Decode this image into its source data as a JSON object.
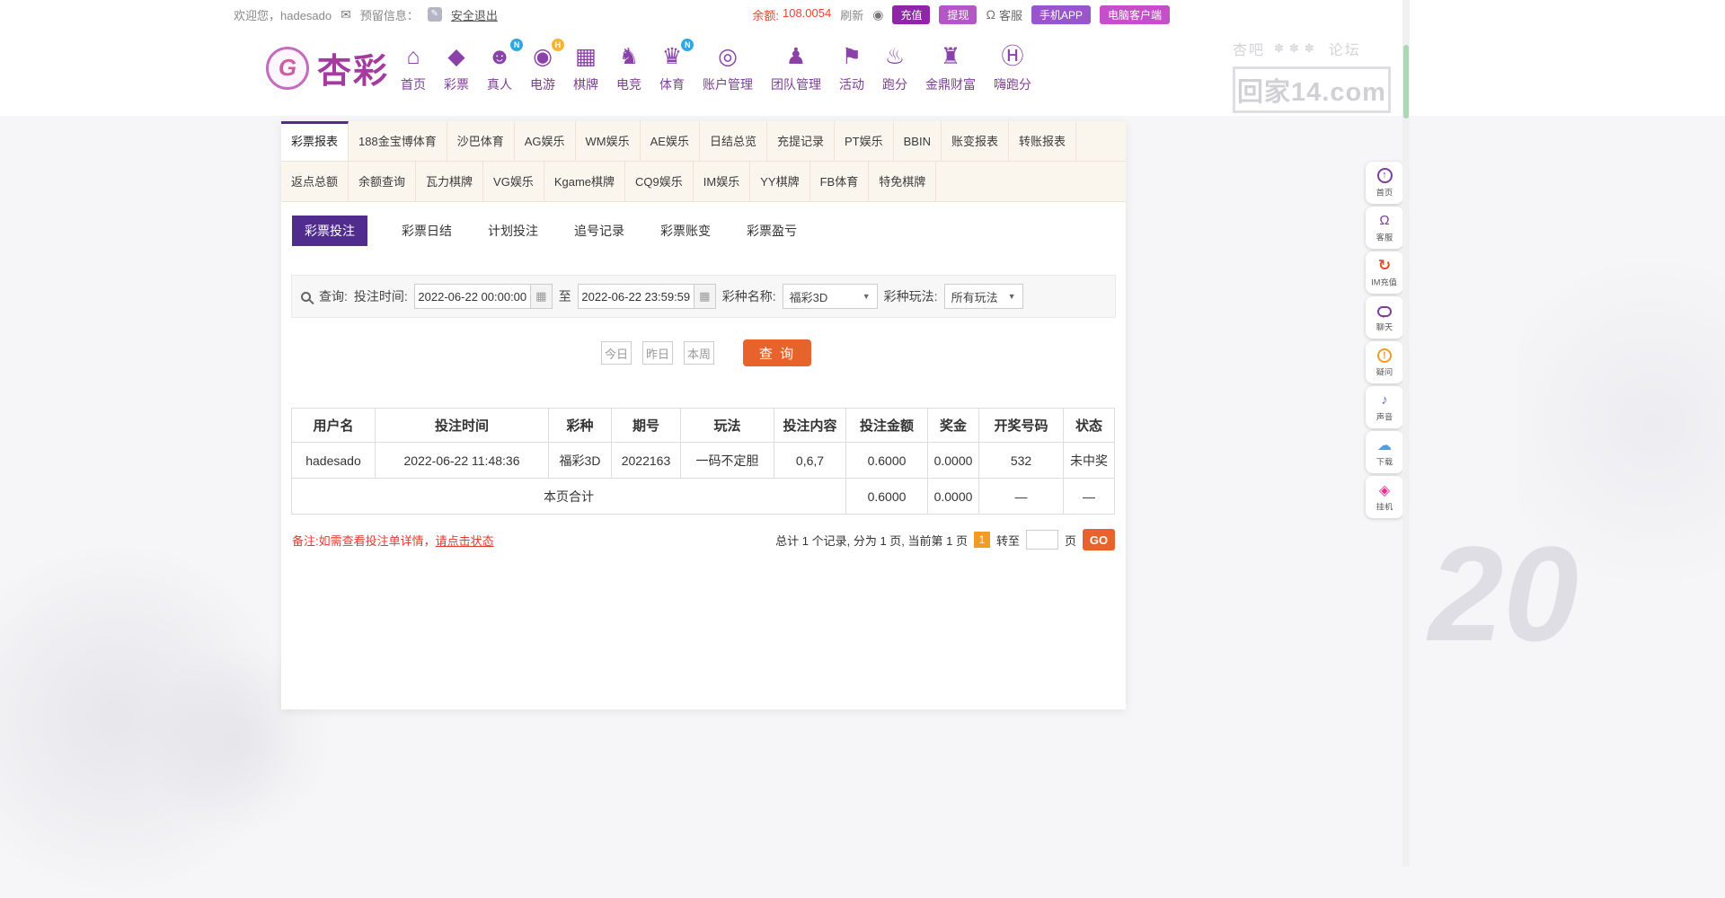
{
  "colors": {
    "brand_purple": "#7d3f98",
    "active_tab_purple": "#4f2c8e",
    "accent_orange": "#e8632c",
    "balance_red": "#e5482e",
    "page_badge_orange": "#f59a23"
  },
  "icons": {
    "mail": "✉",
    "edit": "✎",
    "eye": "◉",
    "headset": "Ω",
    "calendar": "▦",
    "dropdown": "▼"
  },
  "topbar": {
    "welcome": "欢迎您，hadesado",
    "reserved_label": "预留信息：",
    "logout": "安全退出",
    "balance_label": "余额:",
    "balance_value": "108.0054",
    "refresh": "刷新",
    "recharge": "充值",
    "withdraw": "提现",
    "service": "客服",
    "mobile_app": "手机APP",
    "pc_client": "电脑客户端"
  },
  "header": {
    "logo_monogram": "G",
    "logo_text": "杏彩",
    "nav": [
      {
        "label": "首页",
        "glyph": "⌂"
      },
      {
        "label": "彩票",
        "glyph": "◆"
      },
      {
        "label": "真人",
        "glyph": "☻",
        "badge": "N"
      },
      {
        "label": "电游",
        "glyph": "◉",
        "badge": "H"
      },
      {
        "label": "棋牌",
        "glyph": "▦"
      },
      {
        "label": "电竞",
        "glyph": "♞"
      },
      {
        "label": "体育",
        "glyph": "♛",
        "badge": "N"
      },
      {
        "label": "账户管理",
        "glyph": "◎"
      },
      {
        "label": "团队管理",
        "glyph": "♟"
      },
      {
        "label": "活动",
        "glyph": "⚑"
      },
      {
        "label": "跑分",
        "glyph": "♨"
      },
      {
        "label": "金鼎财富",
        "glyph": "♜"
      },
      {
        "label": "嗨跑分",
        "glyph": "Ⓗ"
      }
    ]
  },
  "watermark": {
    "left": "杏吧",
    "ornament": "✽✽✽",
    "right": "论坛",
    "site": "回家14.com",
    "number": "20"
  },
  "tabs": {
    "row1": [
      "彩票报表",
      "188金宝博体育",
      "沙巴体育",
      "AG娱乐",
      "WM娱乐",
      "AE娱乐",
      "日结总览",
      "充提记录",
      "PT娱乐",
      "BBIN",
      "账变报表",
      "转账报表"
    ],
    "row2": [
      "返点总额",
      "余额查询",
      "瓦力棋牌",
      "VG娱乐",
      "Kgame棋牌",
      "CQ9娱乐",
      "IM娱乐",
      "YY棋牌",
      "FB体育",
      "特免棋牌"
    ]
  },
  "subtabs": [
    "彩票投注",
    "彩票日结",
    "计划投注",
    "追号记录",
    "彩票账变",
    "彩票盈亏"
  ],
  "query": {
    "title": "查询:",
    "time_label": "投注时间:",
    "time_from": "2022-06-22 00:00:00",
    "to_label": "至",
    "time_to": "2022-06-22 23:59:59",
    "lottery_label": "彩种名称:",
    "lottery_value": "福彩3D",
    "play_label": "彩种玩法:",
    "play_value": "所有玩法"
  },
  "actions": {
    "quick": [
      "今日",
      "昨日",
      "本周"
    ],
    "search": "查 询"
  },
  "table": {
    "headers": [
      "用户名",
      "投注时间",
      "彩种",
      "期号",
      "玩法",
      "投注内容",
      "投注金额",
      "奖金",
      "开奖号码",
      "状态"
    ],
    "rows": [
      [
        "hadesado",
        "2022-06-22 11:48:36",
        "福彩3D",
        "2022163",
        "一码不定胆",
        "0,6,7",
        "0.6000",
        "0.0000",
        "532",
        "未中奖"
      ]
    ],
    "total_label": "本页合计",
    "total": {
      "bet": "0.6000",
      "prize": "0.0000",
      "draw": "—",
      "status": "—"
    }
  },
  "note": {
    "prefix": "备注:如需查看投注单详情，",
    "link": "请点击状态"
  },
  "pagination": {
    "summary": "总计 1 个记录, 分为 1 页, 当前第 1 页",
    "current": "1",
    "goto_label": "转至",
    "page_unit": "页",
    "go": "GO"
  },
  "sidebar": [
    {
      "label": "首页",
      "glyph": "↑"
    },
    {
      "label": "客服",
      "glyph": "Ω"
    },
    {
      "label": "IM充值",
      "glyph": "↻"
    },
    {
      "label": "聊天",
      "glyph": ""
    },
    {
      "label": "疑问",
      "glyph": "!"
    },
    {
      "label": "声音",
      "glyph": "♪"
    },
    {
      "label": "下载",
      "glyph": "☁"
    },
    {
      "label": "挂机",
      "glyph": "◈"
    }
  ]
}
